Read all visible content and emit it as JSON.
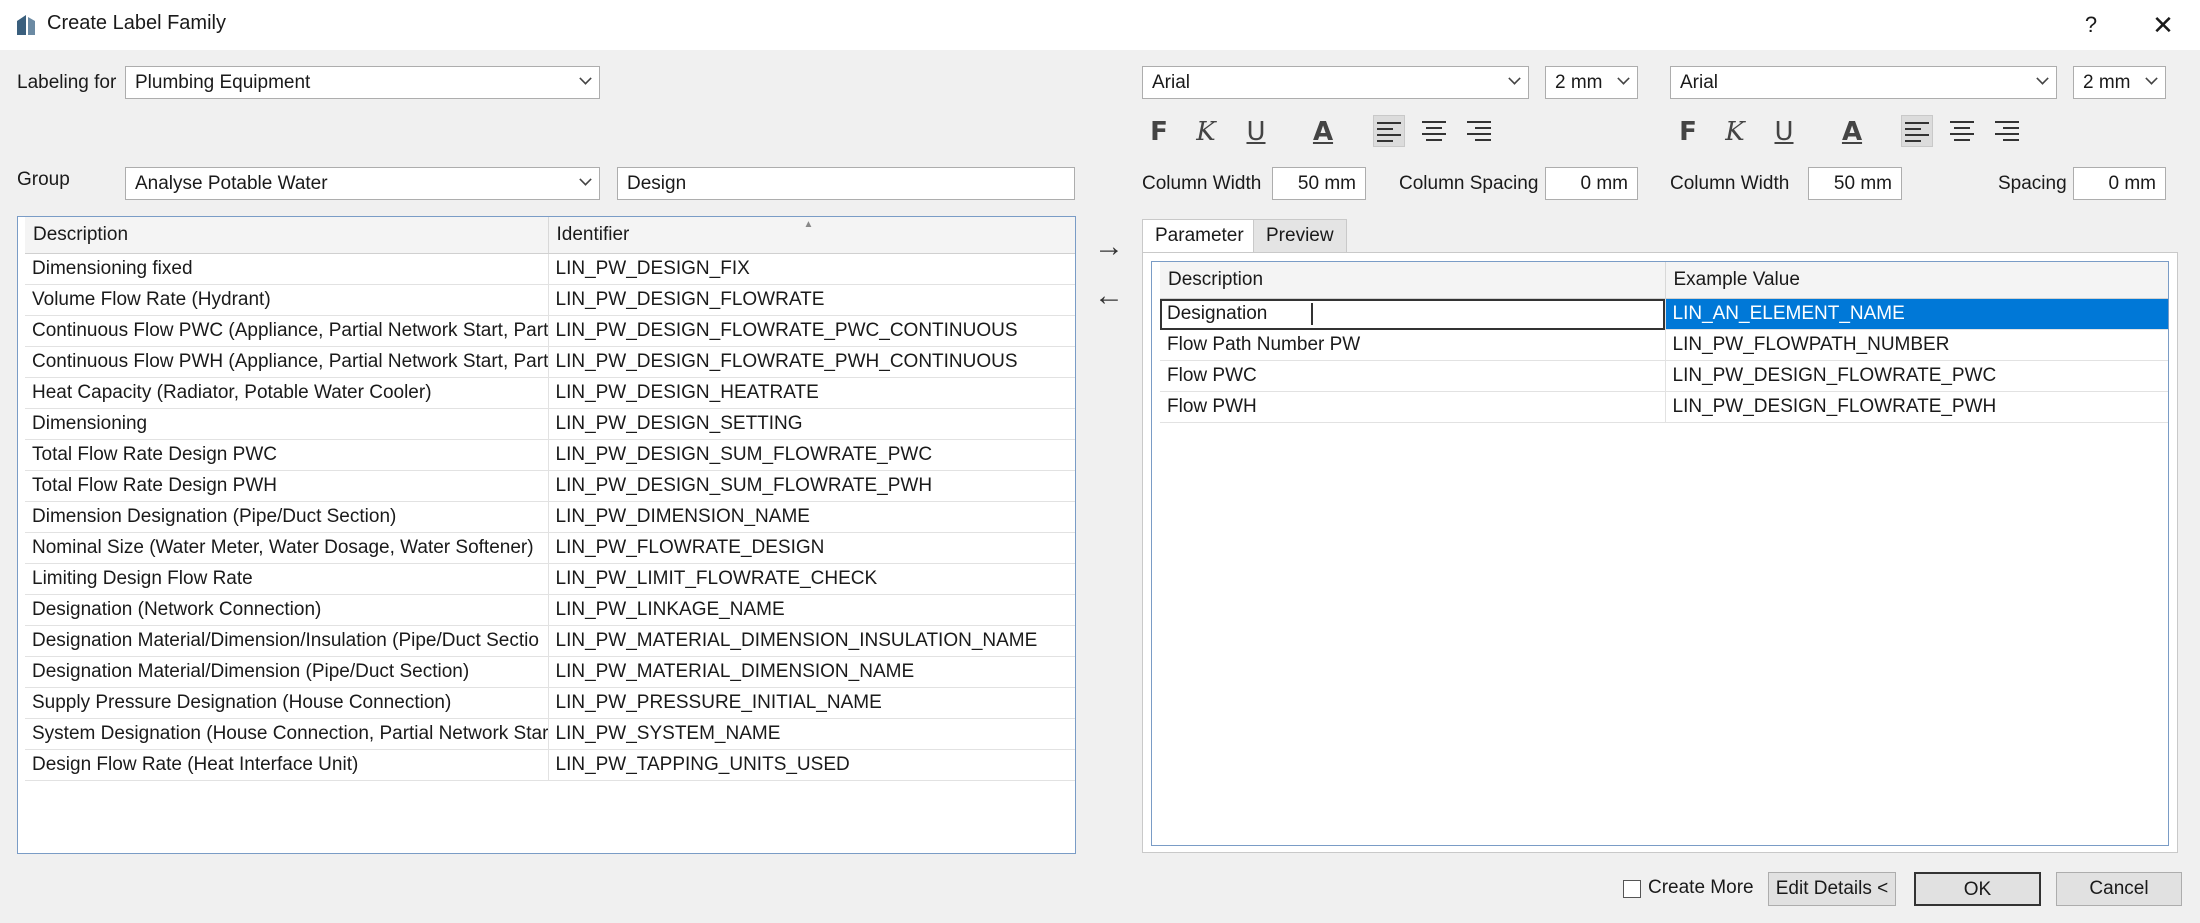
{
  "window": {
    "title": "Create Label Family",
    "help": "?",
    "close": "✕"
  },
  "labeling_for": {
    "label": "Labeling for",
    "value": "Plumbing Equipment"
  },
  "group": {
    "label": "Group",
    "value": "Analyse Potable Water",
    "filter_value": "Design"
  },
  "font_left": {
    "family": "Arial",
    "size": "2 mm"
  },
  "font_right": {
    "family": "Arial",
    "size": "2 mm"
  },
  "format_buttons": {
    "bold": "F",
    "italic": "K",
    "underline": "U",
    "color": "A"
  },
  "column_left": {
    "width_label": "Column Width",
    "width_value": "50 mm",
    "spacing_label": "Column Spacing",
    "spacing_value": "0 mm"
  },
  "column_right": {
    "width_label": "Column Width",
    "width_value": "50 mm",
    "spacing_label": "Spacing",
    "spacing_value": "0 mm"
  },
  "left_table": {
    "headers": [
      "Description",
      "Identifier"
    ],
    "rows": [
      [
        "Dimensioning fixed",
        "LIN_PW_DESIGN_FIX"
      ],
      [
        "Volume Flow Rate (Hydrant)",
        "LIN_PW_DESIGN_FLOWRATE"
      ],
      [
        "Continuous Flow PWC (Appliance, Partial Network Start, Partia",
        "LIN_PW_DESIGN_FLOWRATE_PWC_CONTINUOUS"
      ],
      [
        "Continuous Flow PWH (Appliance, Partial Network Start, Partia",
        "LIN_PW_DESIGN_FLOWRATE_PWH_CONTINUOUS"
      ],
      [
        "Heat Capacity (Radiator, Potable Water Cooler)",
        "LIN_PW_DESIGN_HEATRATE"
      ],
      [
        "Dimensioning",
        "LIN_PW_DESIGN_SETTING"
      ],
      [
        "Total Flow Rate Design PWC",
        "LIN_PW_DESIGN_SUM_FLOWRATE_PWC"
      ],
      [
        "Total Flow Rate Design PWH",
        "LIN_PW_DESIGN_SUM_FLOWRATE_PWH"
      ],
      [
        "Dimension Designation (Pipe/Duct Section)",
        "LIN_PW_DIMENSION_NAME"
      ],
      [
        "Nominal Size (Water Meter, Water Dosage, Water Softener)",
        "LIN_PW_FLOWRATE_DESIGN"
      ],
      [
        "Limiting Design Flow Rate",
        "LIN_PW_LIMIT_FLOWRATE_CHECK"
      ],
      [
        "Designation (Network Connection)",
        "LIN_PW_LINKAGE_NAME"
      ],
      [
        "Designation Material/Dimension/Insulation (Pipe/Duct Sectio",
        "LIN_PW_MATERIAL_DIMENSION_INSULATION_NAME"
      ],
      [
        "Designation Material/Dimension (Pipe/Duct Section)",
        "LIN_PW_MATERIAL_DIMENSION_NAME"
      ],
      [
        "Supply Pressure Designation (House Connection)",
        "LIN_PW_PRESSURE_INITIAL_NAME"
      ],
      [
        "System Designation (House Connection, Partial Network Start",
        "LIN_PW_SYSTEM_NAME"
      ],
      [
        "Design Flow Rate (Heat Interface Unit)",
        "LIN_PW_TAPPING_UNITS_USED"
      ]
    ]
  },
  "move_buttons": {
    "add": "→",
    "remove": "←"
  },
  "tabs": [
    "Parameter",
    "Preview"
  ],
  "right_table": {
    "headers": [
      "Description",
      "Example Value"
    ],
    "rows": [
      [
        "Designation",
        "LIN_AN_ELEMENT_NAME"
      ],
      [
        "Flow Path Number PW",
        "LIN_PW_FLOWPATH_NUMBER"
      ],
      [
        "Flow PWC",
        "LIN_PW_DESIGN_FLOWRATE_PWC"
      ],
      [
        "Flow PWH",
        "LIN_PW_DESIGN_FLOWRATE_PWH"
      ]
    ]
  },
  "footer": {
    "create_more": "Create More",
    "edit_details": "Edit Details <",
    "ok": "OK",
    "cancel": "Cancel"
  },
  "colors": {
    "selection": "#0078d7",
    "panel_border": "#7a9cc6"
  }
}
